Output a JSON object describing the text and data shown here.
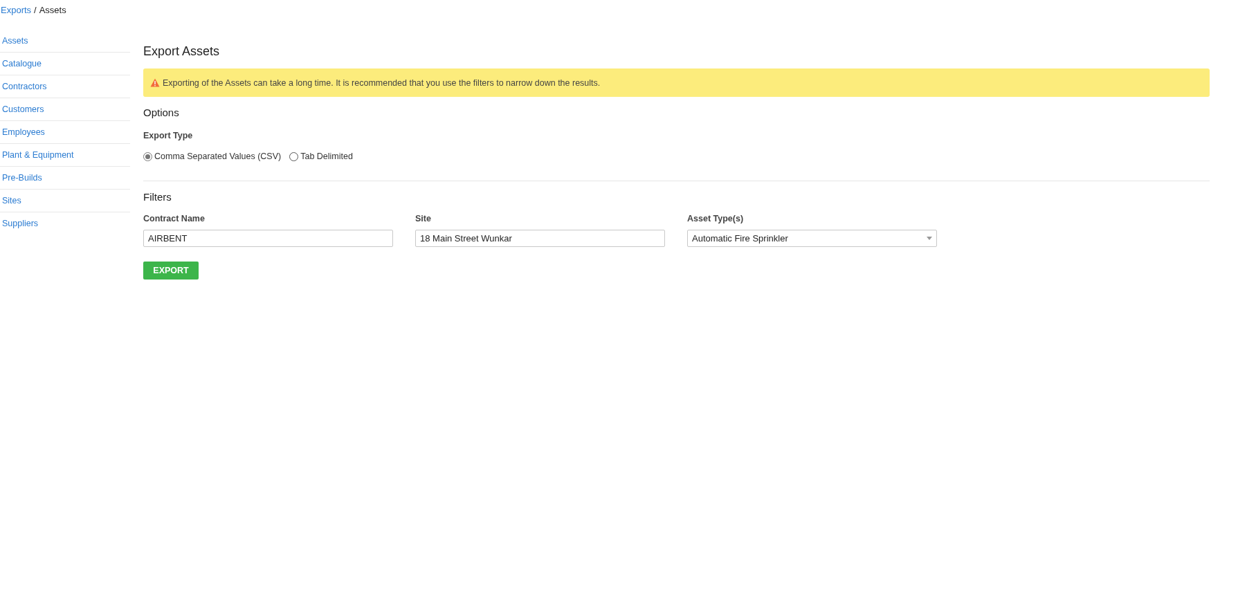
{
  "breadcrumb": {
    "separator": "/",
    "items": [
      {
        "label": "Exports",
        "link": true
      },
      {
        "label": "Assets",
        "link": false
      }
    ]
  },
  "sidebar": {
    "items": [
      {
        "label": "Assets"
      },
      {
        "label": "Catalogue"
      },
      {
        "label": "Contractors"
      },
      {
        "label": "Customers"
      },
      {
        "label": "Employees"
      },
      {
        "label": "Plant & Equipment"
      },
      {
        "label": "Pre-Builds"
      },
      {
        "label": "Sites"
      },
      {
        "label": "Suppliers"
      }
    ]
  },
  "title": "Export Assets",
  "alert": "Exporting of the Assets can take a long time. It is recommended that you use the filters to narrow down the results.",
  "options": {
    "heading": "Options",
    "export_type_label": "Export Type",
    "export_types": [
      {
        "label": "Comma Separated Values (CSV)",
        "selected": true
      },
      {
        "label": "Tab Delimited",
        "selected": false
      }
    ]
  },
  "filters": {
    "heading": "Filters",
    "fields": [
      {
        "kind": "text",
        "label": "Contract Name",
        "value": "AIRBENT"
      },
      {
        "kind": "text",
        "label": "Site",
        "value": "18 Main Street Wunkar"
      },
      {
        "kind": "select",
        "label": "Asset Type(s)",
        "value": "Automatic Fire Sprinkler"
      }
    ]
  },
  "export_button": "EXPORT"
}
